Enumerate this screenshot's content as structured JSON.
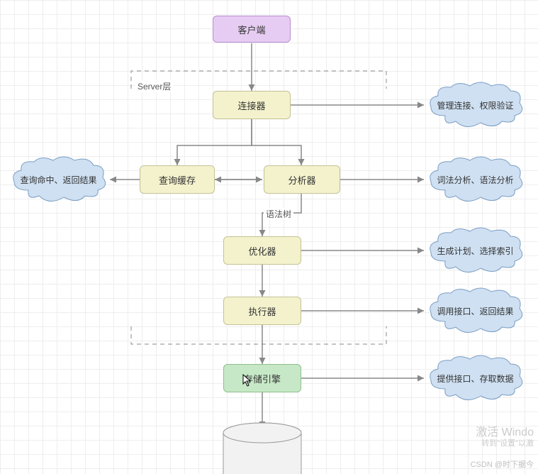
{
  "nodes": {
    "client": "客户端",
    "connector": "连接器",
    "cache": "查询缓存",
    "analyzer": "分析器",
    "optimizer": "优化器",
    "executor": "执行器",
    "engine": "存储引擎"
  },
  "clouds": {
    "connector_note": "管理连接、权限验证",
    "cache_note": "查询命中、返回结果",
    "analyzer_note": "词法分析、语法分析",
    "optimizer_note": "生成计划、选择索引",
    "executor_note": "调用接口、返回结果",
    "engine_note": "提供接口、存取数据"
  },
  "labels": {
    "server_layer": "Server层",
    "syntax_tree": "语法树"
  },
  "watermarks": {
    "activate": "激活 Windo",
    "activate_sub": "转到\"设置\"以激",
    "csdn": "CSDN @时下据今"
  },
  "colors": {
    "arrow": "#888888",
    "cloud_fill": "#cfe0f2",
    "cloud_stroke": "#7a9dc4",
    "dashed": "#888888"
  }
}
